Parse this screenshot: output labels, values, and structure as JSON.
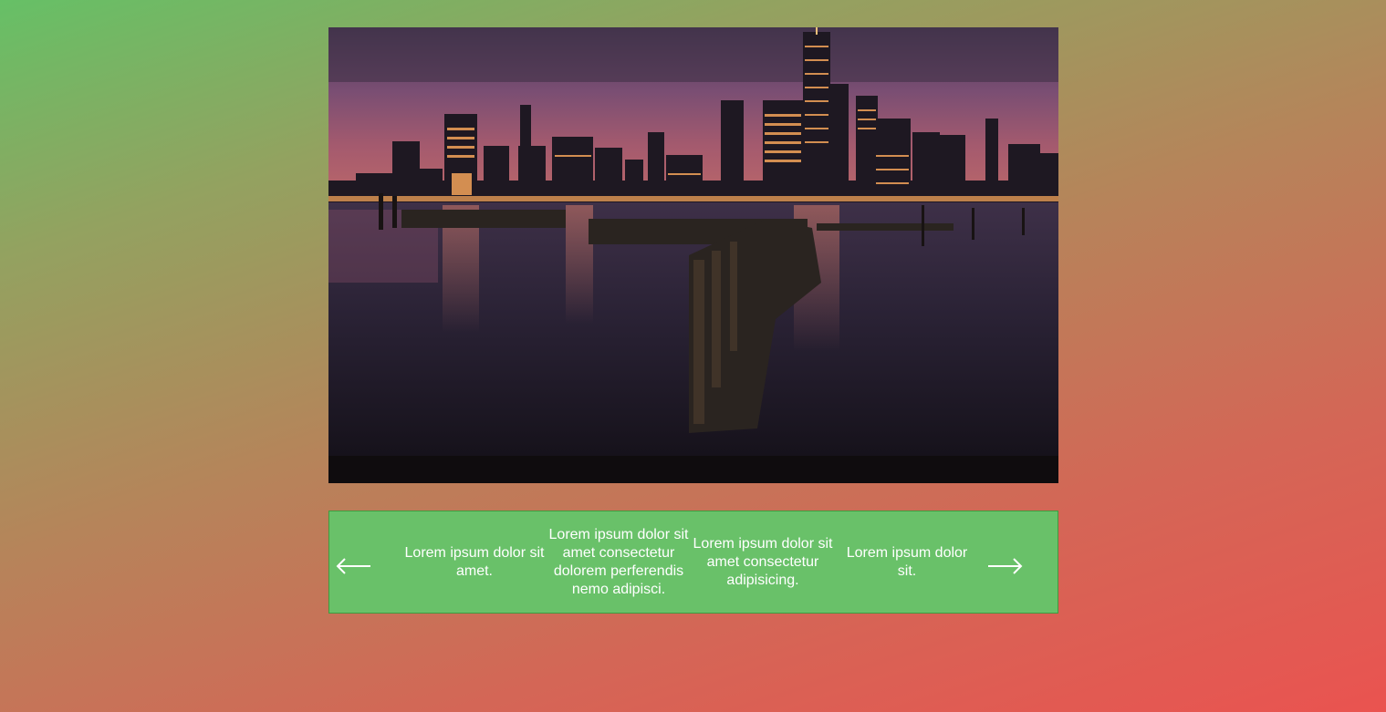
{
  "slider": {
    "image": {
      "name": "city-skyline-pier-night-photo"
    },
    "prev_icon": "arrow-left-icon",
    "next_icon": "arrow-right-icon",
    "captions": [
      {
        "text": "Lorem ipsum dolor sit amet."
      },
      {
        "text": "Lorem ipsum dolor sit amet consectetur dolorem perferendis nemo adipisci."
      },
      {
        "text": "Lorem ipsum dolor sit amet consectetur adipisicing."
      },
      {
        "text": "Lorem ipsum dolor sit."
      }
    ]
  },
  "colors": {
    "background_top_left": "#66c066",
    "background_bottom_right": "#ea5350",
    "caption_bar": "#69c169",
    "caption_text": "#ffffff"
  }
}
